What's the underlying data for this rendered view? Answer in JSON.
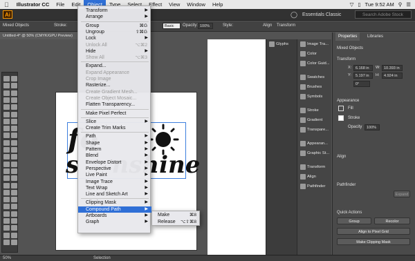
{
  "menubar": {
    "app_name": "Illustrator CC",
    "items": [
      "File",
      "Edit",
      "Object",
      "Type",
      "Select",
      "Effect",
      "View",
      "Window",
      "Help"
    ],
    "active": "Object",
    "clock": "Tue 9:52 AM"
  },
  "appbar": {
    "workspace": "Essentials Classic",
    "search_placeholder": "Search Adobe Stock"
  },
  "controlbar": {
    "left_label": "Mixed Objects",
    "stroke_label": "Stroke:",
    "basic_label": "Basic",
    "opacity_label": "Opacity:",
    "opacity_value": "100%",
    "style_label": "Style:",
    "align_label": "Align",
    "transform_label": "Transform"
  },
  "doc_tab": {
    "title": "Untitled-4* @ 50% (CMYK/GPU Preview)"
  },
  "object_menu": {
    "items": [
      {
        "label": "Transform",
        "submenu": true
      },
      {
        "label": "Arrange",
        "submenu": true
      },
      {
        "label": "Group",
        "shortcut": "⌘G"
      },
      {
        "label": "Ungroup",
        "shortcut": "⇧⌘G"
      },
      {
        "label": "Lock",
        "submenu": true
      },
      {
        "label": "Unlock All",
        "shortcut": "⌥⌘2",
        "disabled": true
      },
      {
        "label": "Hide",
        "submenu": true
      },
      {
        "label": "Show All",
        "shortcut": "⌥⌘3",
        "disabled": true
      },
      {
        "label": "Expand..."
      },
      {
        "label": "Expand Appearance",
        "disabled": true
      },
      {
        "label": "Crop Image",
        "disabled": true
      },
      {
        "label": "Rasterize..."
      },
      {
        "label": "Create Gradient Mesh...",
        "disabled": true
      },
      {
        "label": "Create Object Mosaic...",
        "disabled": true
      },
      {
        "label": "Flatten Transparency..."
      },
      {
        "label": "Make Pixel Perfect"
      },
      {
        "label": "Slice",
        "submenu": true
      },
      {
        "label": "Create Trim Marks"
      },
      {
        "label": "Path",
        "submenu": true
      },
      {
        "label": "Shape",
        "submenu": true
      },
      {
        "label": "Pattern",
        "submenu": true
      },
      {
        "label": "Blend",
        "submenu": true
      },
      {
        "label": "Envelope Distort",
        "submenu": true
      },
      {
        "label": "Perspective",
        "submenu": true
      },
      {
        "label": "Live Paint",
        "submenu": true
      },
      {
        "label": "Image Trace",
        "submenu": true
      },
      {
        "label": "Text Wrap",
        "submenu": true
      },
      {
        "label": "Line and Sketch Art",
        "submenu": true
      },
      {
        "label": "Clipping Mask",
        "submenu": true
      },
      {
        "label": "Compound Path",
        "submenu": true,
        "highlighted": true
      },
      {
        "label": "Artboards",
        "submenu": true
      },
      {
        "label": "Graph",
        "submenu": true
      }
    ]
  },
  "compound_path_submenu": {
    "items": [
      {
        "label": "Make",
        "shortcut": "⌘8"
      },
      {
        "label": "Release",
        "shortcut": "⌥⇧⌘8"
      }
    ]
  },
  "panels_col1": [
    "Glyphs",
    "Image Tra...",
    "Color",
    "Color Guid...",
    "Swatches",
    "Brushes",
    "Symbols",
    "Stroke",
    "Gradient",
    "Transpare...",
    "Appearan...",
    "Graphic St...",
    "Transform",
    "Align",
    "Pathfinder"
  ],
  "properties": {
    "tab_properties": "Properties",
    "tab_libraries": "Libraries",
    "selection": "Mixed Objects",
    "transform_header": "Transform",
    "x_label": "X:",
    "x_value": "6.168 in",
    "y_label": "Y:",
    "y_value": "5.197 in",
    "w_label": "W:",
    "w_value": "10.393 in",
    "h_label": "H:",
    "h_value": "4.924 in",
    "angle_value": "0°",
    "appearance_header": "Appearance",
    "fill_label": "Fill",
    "stroke_label": "Stroke",
    "opacity_label": "Opacity",
    "opacity_value": "100%",
    "align_header": "Align",
    "pathfinder_header": "Pathfinder",
    "expand_label": "Expand",
    "quick_actions_header": "Quick Actions",
    "group_btn": "Group",
    "recolor_btn": "Recolor",
    "align_pixel_btn": "Align to Pixel Grid",
    "clipping_btn": "Make Clipping Mask"
  },
  "status": {
    "zoom": "50%",
    "tool": "Selection"
  },
  "artwork": {
    "line1": "fo",
    "line2": "s    nshine"
  }
}
